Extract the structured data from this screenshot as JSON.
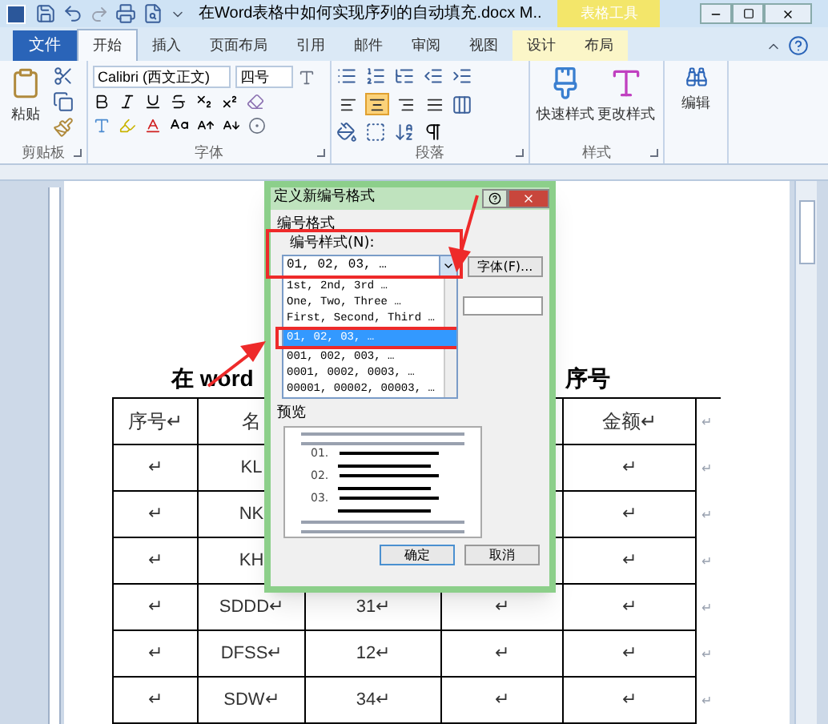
{
  "window": {
    "title": "在Word表格中如何实现序列的自动填充.docx M..",
    "context_group": "表格工具"
  },
  "file_tab": "文件",
  "tabs": [
    {
      "label": "开始",
      "selected": true,
      "contextual": false
    },
    {
      "label": "插入",
      "selected": false,
      "contextual": false
    },
    {
      "label": "页面布局",
      "selected": false,
      "contextual": false
    },
    {
      "label": "引用",
      "selected": false,
      "contextual": false
    },
    {
      "label": "邮件",
      "selected": false,
      "contextual": false
    },
    {
      "label": "审阅",
      "selected": false,
      "contextual": false
    },
    {
      "label": "视图",
      "selected": false,
      "contextual": false
    },
    {
      "label": "设计",
      "selected": false,
      "contextual": true
    },
    {
      "label": "布局",
      "selected": false,
      "contextual": true
    }
  ],
  "ribbon": {
    "clipboard": {
      "paste": "粘贴",
      "label": "剪贴板"
    },
    "font": {
      "name": "Calibri (西文正文)",
      "size": "四号",
      "label": "字体"
    },
    "paragraph": {
      "label": "段落",
      "alignment": [
        {
          "kind": "left",
          "selected": false
        },
        {
          "kind": "center",
          "selected": true
        },
        {
          "kind": "right",
          "selected": false
        },
        {
          "kind": "justify",
          "selected": false
        }
      ]
    },
    "styles": {
      "buttons": [
        "快速样式",
        "更改样式"
      ],
      "label": "样式"
    },
    "editing": {
      "button": "编辑"
    }
  },
  "document": {
    "heading_left": "在 word",
    "heading_right": "序号",
    "header": {
      "cells": [
        "序号↵",
        "名",
        null,
        null,
        "金额↵"
      ],
      "end_mark": "↵"
    },
    "rows": [
      {
        "cells": [
          "↵",
          "KL",
          null,
          null,
          "↵"
        ],
        "end_mark": "↵"
      },
      {
        "cells": [
          "↵",
          "NK",
          null,
          null,
          "↵"
        ],
        "end_mark": "↵"
      },
      {
        "cells": [
          "↵",
          "KH",
          null,
          null,
          "↵"
        ],
        "end_mark": "↵"
      },
      {
        "cells": [
          "↵",
          "SDDD↵",
          "31↵",
          "↵",
          "↵"
        ],
        "end_mark": "↵"
      },
      {
        "cells": [
          "↵",
          "DFSS↵",
          "12↵",
          "↵",
          "↵"
        ],
        "end_mark": "↵"
      },
      {
        "cells": [
          "↵",
          "SDW↵",
          "34↵",
          "↵",
          "↵"
        ],
        "end_mark": "↵"
      }
    ]
  },
  "dialog": {
    "title": "定义新编号格式",
    "section": "编号格式",
    "style_label": "编号样式(N):",
    "style_value": "01, 02, 03, …",
    "font_button": "字体(F)...",
    "options": [
      {
        "label": "1st, 2nd, 3rd …",
        "selected": false
      },
      {
        "label": "One, Two, Three …",
        "selected": false
      },
      {
        "label": "First, Second, Third …",
        "selected": false
      },
      {
        "label": "01, 02, 03, …",
        "selected": true
      },
      {
        "label": "001, 002, 003, …",
        "selected": false
      },
      {
        "label": "0001, 0002, 0003, …",
        "selected": false
      },
      {
        "label": "00001, 00002, 00003, …",
        "selected": false
      }
    ],
    "preview_label": "预览",
    "preview_numbers": [
      "01.",
      "02.",
      "03."
    ],
    "buttons": [
      "确定",
      "取消"
    ]
  }
}
